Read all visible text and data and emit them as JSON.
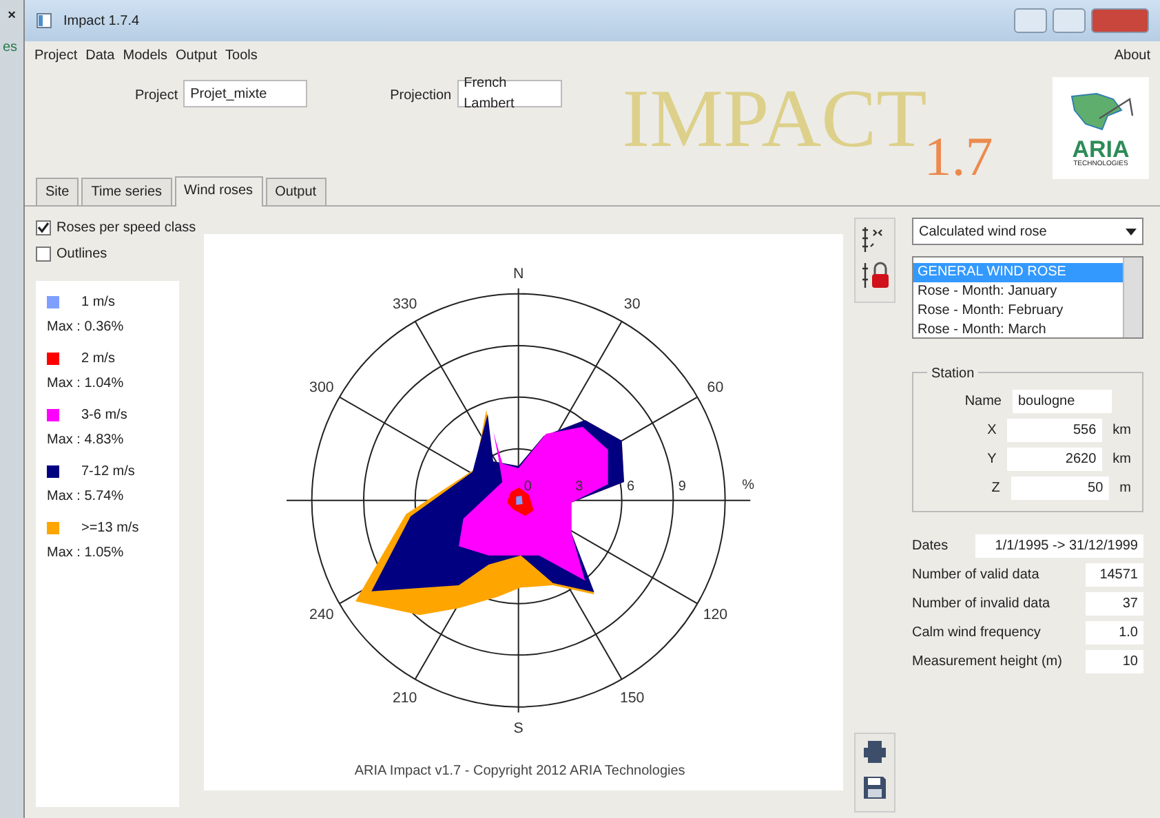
{
  "background_window": {
    "close": "×",
    "text": "es"
  },
  "window": {
    "title": "Impact 1.7.4"
  },
  "menu": [
    {
      "label": "Project"
    },
    {
      "label": "Data"
    },
    {
      "label": "Models"
    },
    {
      "label": "Output"
    },
    {
      "label": "Tools"
    }
  ],
  "menu_right": "About",
  "project": {
    "label": "Project",
    "value": "Projet_mixte"
  },
  "projection": {
    "label": "Projection",
    "value": "French Lambert"
  },
  "logo": {
    "title": "IMPACT",
    "version": "1.7",
    "brand": "ARIA",
    "brand_sub": "TECHNOLOGIES"
  },
  "tabs": [
    {
      "label": "Site",
      "selected": false
    },
    {
      "label": "Time series",
      "selected": false
    },
    {
      "label": "Wind roses",
      "selected": true
    },
    {
      "label": "Output",
      "selected": false
    }
  ],
  "options": [
    {
      "label": "Roses per speed class",
      "checked": true
    },
    {
      "label": "Outlines",
      "checked": false
    }
  ],
  "legend": [
    {
      "label": "1  m/s",
      "max": "Max : 0.36%",
      "color": "#7f9fff"
    },
    {
      "label": "2  m/s",
      "max": "Max : 1.04%",
      "color": "#ff0000"
    },
    {
      "label": "3-6  m/s",
      "max": "Max : 4.83%",
      "color": "#ff00ff"
    },
    {
      "label": "7-12 m/s",
      "max": "Max : 5.74%",
      "color": "#000080"
    },
    {
      "label": ">=13 m/s",
      "max": "Max : 1.05%",
      "color": "#ffa500"
    }
  ],
  "chart": {
    "direction_labels": [
      "N",
      "30",
      "60",
      "120",
      "150",
      "S",
      "210",
      "240",
      "300",
      "330"
    ],
    "ring_labels": [
      "0",
      "3",
      "6",
      "9"
    ],
    "unit": "%",
    "footer": "ARIA Impact v1.7 - Copyright 2012 ARIA Technologies"
  },
  "rose_type": "Calculated wind rose",
  "rose_list": [
    {
      "label": "GENERAL WIND ROSE",
      "selected": true
    },
    {
      "label": "Rose - Month: January",
      "selected": false
    },
    {
      "label": "Rose - Month: February",
      "selected": false
    },
    {
      "label": "Rose - Month: March",
      "selected": false
    }
  ],
  "station": {
    "title": "Station",
    "fields": [
      {
        "label": "Name",
        "value": "boulogne"
      },
      {
        "label": "X",
        "value": "556",
        "unit": "km"
      },
      {
        "label": "Y",
        "value": "2620",
        "unit": "km"
      },
      {
        "label": "Z",
        "value": "50",
        "unit": "m"
      }
    ]
  },
  "dates": {
    "label": "Dates",
    "value": "1/1/1995 -> 31/12/1999"
  },
  "stats": [
    {
      "label": "Number of valid data",
      "value": "14571"
    },
    {
      "label": "Number of invalid data",
      "value": "37"
    },
    {
      "label": "Calm wind frequency",
      "value": "1.0"
    },
    {
      "label": "Measurement height (m)",
      "value": "10"
    }
  ]
}
